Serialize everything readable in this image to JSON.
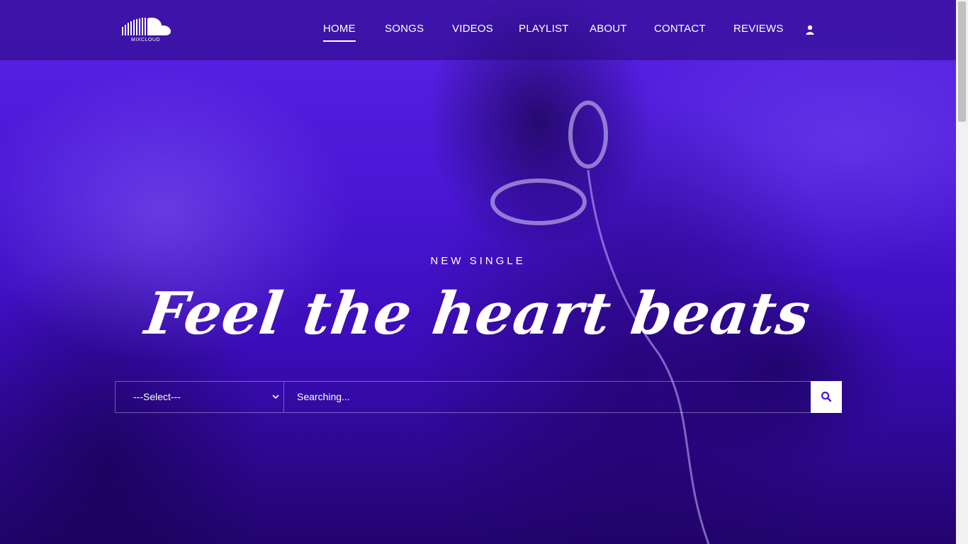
{
  "brand": {
    "name": "MIXCLOUD",
    "accent": "#5a22e6"
  },
  "nav": {
    "items": [
      {
        "label": "HOME",
        "active": true
      },
      {
        "label": "SONGS"
      },
      {
        "label": "VIDEOS"
      },
      {
        "label": "PLAYLIST"
      },
      {
        "label": "ABOUT"
      },
      {
        "label": "CONTACT"
      },
      {
        "label": "REVIEWS"
      }
    ],
    "user_icon": "user-icon"
  },
  "hero": {
    "kicker": "NEW SINGLE",
    "headline": "Feel the heart beats"
  },
  "search": {
    "select_value": "---Select---",
    "query_placeholder": "Searching...",
    "button_icon": "search-icon"
  }
}
